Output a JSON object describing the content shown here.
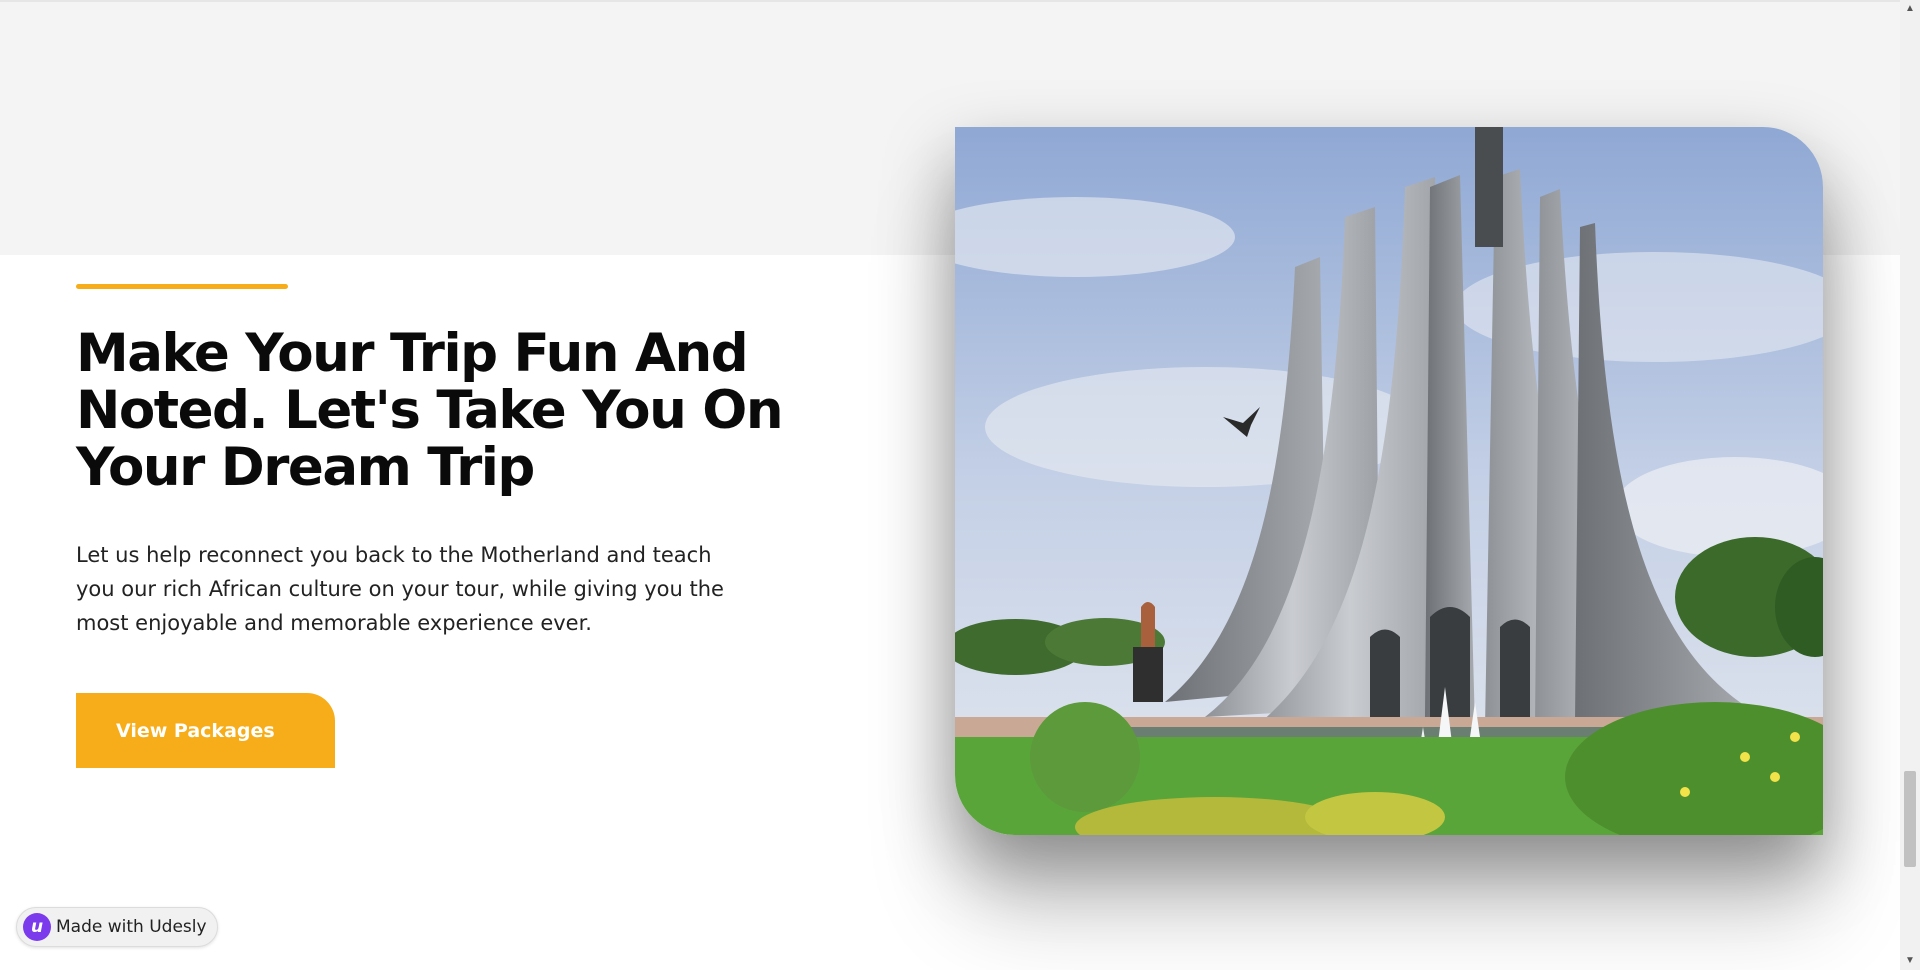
{
  "hero": {
    "headline": "Make Your Trip Fun And Noted. Let's Take You On Your Dream Trip",
    "description": "Let us help reconnect you back to the Motherland and teach you our rich African culture on your tour, while giving you the most enjoyable and memorable experience ever.",
    "cta_label": "View Packages"
  },
  "image": {
    "subject": "Kwame Nkrumah Memorial Park monument"
  },
  "badge": {
    "logo_letter": "u",
    "text": "Made with Udesly"
  },
  "colors": {
    "accent": "#f7ad19",
    "band": "#f4f4f4",
    "badge_logo": "#7c3aed"
  },
  "scrollbar": {
    "up_icon": "triangle-up",
    "down_icon": "triangle-down"
  }
}
